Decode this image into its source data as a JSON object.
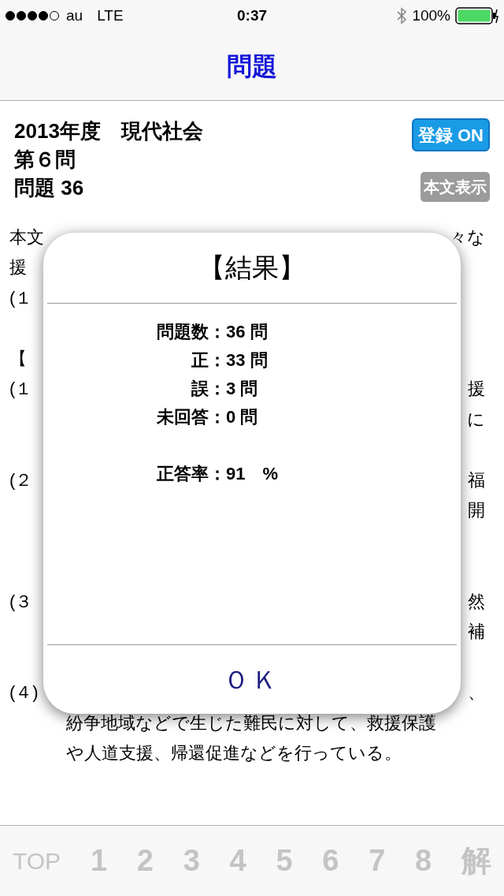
{
  "status_bar": {
    "carrier": "au",
    "network": "LTE",
    "time": "0:37",
    "battery": "100%"
  },
  "nav": {
    "title": "問題"
  },
  "header": {
    "lines": [
      "2013年度　現代社会",
      "第６問",
      "問題 36"
    ],
    "buttons": [
      {
        "label": "登録 ON",
        "kind": "primary"
      },
      {
        "label": "本文表示",
        "kind": "secondary"
      }
    ]
  },
  "body_rows": [
    {
      "kind": "text",
      "left": "本文",
      "right": "々な"
    },
    {
      "kind": "text",
      "left": "援"
    },
    {
      "kind": "text",
      "left": "(１"
    },
    {
      "kind": "gap"
    },
    {
      "kind": "text",
      "left": "【"
    },
    {
      "kind": "text",
      "left": "(１",
      "right": "援"
    },
    {
      "kind": "text",
      "right": "に"
    },
    {
      "kind": "gap"
    },
    {
      "kind": "text",
      "left": "(２",
      "right": "福"
    },
    {
      "kind": "text",
      "right": "開"
    },
    {
      "kind": "gap"
    },
    {
      "kind": "gap"
    },
    {
      "kind": "text",
      "left": "(３",
      "right": "然"
    },
    {
      "kind": "text",
      "right": "補"
    },
    {
      "kind": "gap"
    },
    {
      "kind": "text",
      "left": "(４)",
      "right": "、"
    },
    {
      "kind": "indent",
      "left": "紛争地域などで生じた難民に対して、救援保護"
    },
    {
      "kind": "indent",
      "left": "や人道支援、帰還促進などを行っている。"
    }
  ],
  "dialog": {
    "title": "【結果】",
    "stats": [
      {
        "label": "問題数",
        "value": "36 問"
      },
      {
        "label": "正",
        "value": "33 問"
      },
      {
        "label": "誤",
        "value": "3 問"
      },
      {
        "label": "未回答",
        "value": "0 問"
      }
    ],
    "rate": {
      "label": "正答率",
      "value": "91　%"
    },
    "colon": "：",
    "button": "ＯＫ"
  },
  "tab_bar": [
    {
      "label": "TOP",
      "selected": false
    },
    {
      "label": "1",
      "selected": false
    },
    {
      "label": "2",
      "selected": false
    },
    {
      "label": "3",
      "selected": false
    },
    {
      "label": "4",
      "selected": false
    },
    {
      "label": "5",
      "selected": false
    },
    {
      "label": "6",
      "selected": false
    },
    {
      "label": "7",
      "selected": false
    },
    {
      "label": "8",
      "selected": false
    },
    {
      "label": "解",
      "selected": false
    }
  ]
}
